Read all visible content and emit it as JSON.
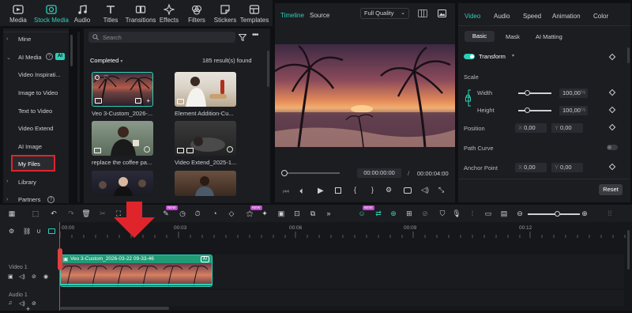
{
  "toolbar": {
    "tabs": [
      {
        "label": "Media",
        "icon": "media-icon"
      },
      {
        "label": "Stock Media",
        "icon": "stock-media-icon"
      },
      {
        "label": "Audio",
        "icon": "audio-icon"
      },
      {
        "label": "Titles",
        "icon": "titles-icon"
      },
      {
        "label": "Transitions",
        "icon": "transitions-icon"
      },
      {
        "label": "Effects",
        "icon": "effects-icon"
      },
      {
        "label": "Filters",
        "icon": "filters-icon"
      },
      {
        "label": "Stickers",
        "icon": "stickers-icon"
      },
      {
        "label": "Templates",
        "icon": "templates-icon"
      }
    ],
    "active": "Stock Media",
    "accent": "#2ad1b7"
  },
  "sidebar": {
    "mine": "Mine",
    "ai_media": "AI Media",
    "ai_badge": "AI",
    "items": [
      "Video Inspirati...",
      "Image to Video",
      "Text to Video",
      "Video Extend",
      "AI Image",
      "My Files"
    ],
    "library": "Library",
    "partners": "Partners",
    "highlight_color": "#e0242b"
  },
  "media": {
    "search_placeholder": "Search",
    "status": "Completed",
    "results": "185 result(s) found",
    "items": [
      {
        "caption": "Veo 3-Custom_2026-..."
      },
      {
        "caption": "Element Addition-Cu..."
      },
      {
        "caption": "replace the coffee pa..."
      },
      {
        "caption": "Video Extend_2025-1..."
      },
      {
        "caption": ""
      },
      {
        "caption": ""
      }
    ]
  },
  "preview": {
    "tab_timeline": "Timeline",
    "tab_source": "Source",
    "quality": "Full Quality",
    "current_time": "00:00:00:00",
    "separator": "/",
    "total_time": "00:00:04:00"
  },
  "props": {
    "tabs": [
      "Video",
      "Audio",
      "Speed",
      "Animation",
      "Color"
    ],
    "subtabs": [
      "Basic",
      "Mask",
      "AI Matting"
    ],
    "transform": "Transform",
    "scale": "Scale",
    "width_label": "Width",
    "width_value": "100,00",
    "height_label": "Height",
    "height_value": "100,00",
    "percent": "%",
    "position": "Position",
    "pos_x_label": "X",
    "pos_x": "0,00",
    "pos_y_label": "Y",
    "pos_y": "0,00",
    "path_curve": "Path Curve",
    "anchor_point": "Anchor Point",
    "anchor_x": "0,00",
    "anchor_y": "0,00",
    "reset": "Reset"
  },
  "timeline": {
    "ruler": [
      "00:00",
      "00:03",
      "00:06",
      "00:09",
      "00:12"
    ],
    "video_track": "Video 1",
    "audio_track": "Audio 1",
    "clip_title": "Veo 3-Custom_2026-03-22 09-33-46",
    "clip_badge": "AI",
    "new_badge": "NEW",
    "clip_color": "#1f9b76"
  }
}
